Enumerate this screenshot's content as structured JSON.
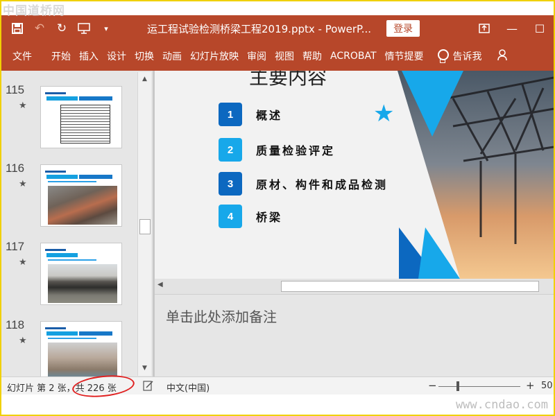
{
  "watermark": {
    "top": "中国道桥网",
    "bottom": "www.cndao.com"
  },
  "titlebar": {
    "doc_title": "运工程试验检测桥梁工程2019.pptx  -  PowerP...",
    "login_label": "登录",
    "icons": [
      "save-icon",
      "undo-icon",
      "redo-icon",
      "start-slideshow-icon",
      "customize-qat-icon",
      "ribbon-display-options-icon",
      "minimize-icon",
      "maximize-icon"
    ]
  },
  "ribbon": {
    "tabs": [
      "文件",
      "开始",
      "插入",
      "设计",
      "切换",
      "动画",
      "幻灯片放映",
      "审阅",
      "视图",
      "帮助",
      "ACROBAT",
      "情节提要"
    ],
    "tell_me": "告诉我"
  },
  "thumbnails": [
    {
      "number": "115",
      "star": "★"
    },
    {
      "number": "116",
      "star": "★"
    },
    {
      "number": "117",
      "star": "★"
    },
    {
      "number": "118",
      "star": "★"
    }
  ],
  "slide": {
    "title": "主要内容",
    "items": [
      {
        "num": "1",
        "text": "概述",
        "tone": "dark"
      },
      {
        "num": "2",
        "text": "质量检验评定",
        "tone": "light"
      },
      {
        "num": "3",
        "text": "原材、构件和成品检测",
        "tone": "dark"
      },
      {
        "num": "4",
        "text": "桥梁",
        "tone": "light"
      }
    ],
    "accent_colors": {
      "dark_blue": "#0c68c0",
      "light_blue": "#17a8ea"
    }
  },
  "notes": {
    "placeholder": "单击此处添加备注"
  },
  "statusbar": {
    "slide_info": "幻灯片 第 2 张，共 226 张",
    "language": "中文(中国)",
    "zoom": "50"
  }
}
